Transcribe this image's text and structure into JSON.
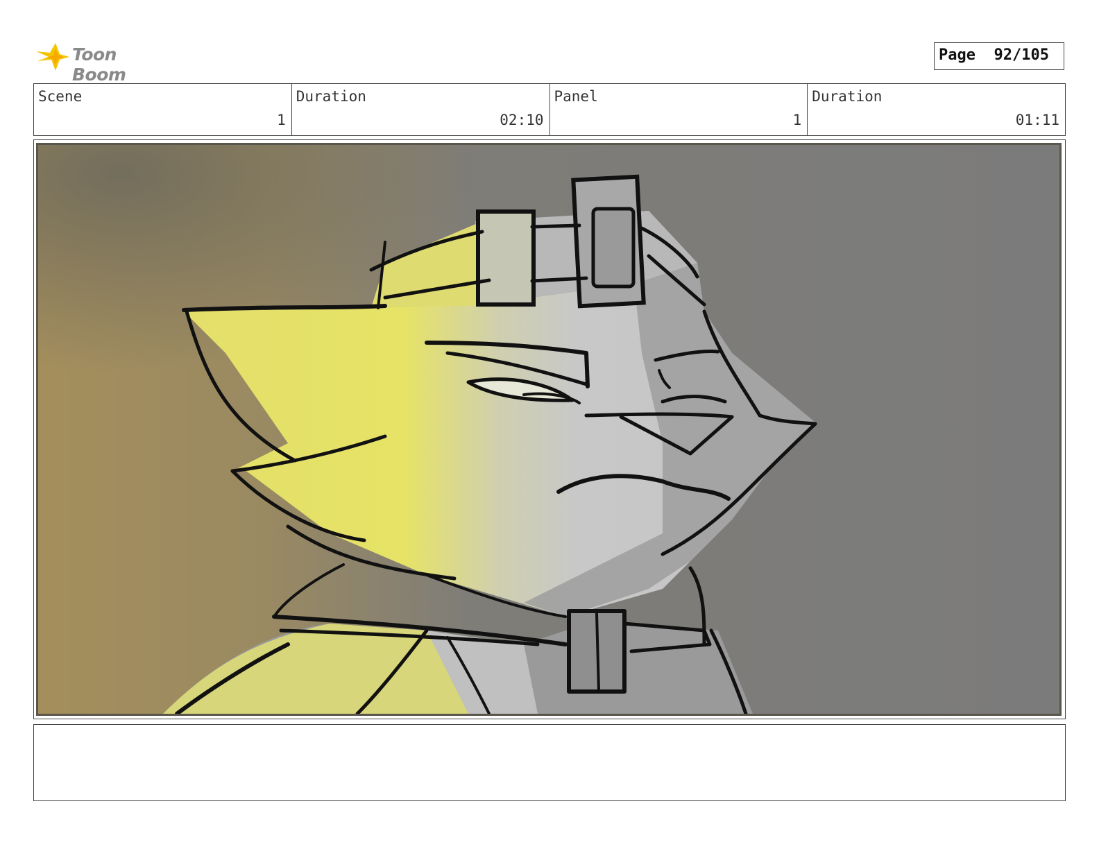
{
  "header": {
    "logo_text": "Toon Boom",
    "logo_icon": "starburst-logo-icon",
    "page_label": "Page",
    "page_number": "92/105"
  },
  "info": {
    "scene_label": "Scene",
    "scene_value": "1",
    "scene_duration_label": "Duration",
    "scene_duration_value": "02:10",
    "panel_label": "Panel",
    "panel_value": "1",
    "panel_duration_label": "Duration",
    "panel_duration_value": "01:11"
  },
  "panel": {
    "image_description": "storyboard-sketch-character-closeup",
    "colors": {
      "background_dark": "#7d7d7d",
      "background_warm": "#a08a5a",
      "rim_light": "#e8e36a",
      "face_fill": "#c9c9c9",
      "line": "#111111"
    }
  },
  "notes": {
    "text": ""
  }
}
